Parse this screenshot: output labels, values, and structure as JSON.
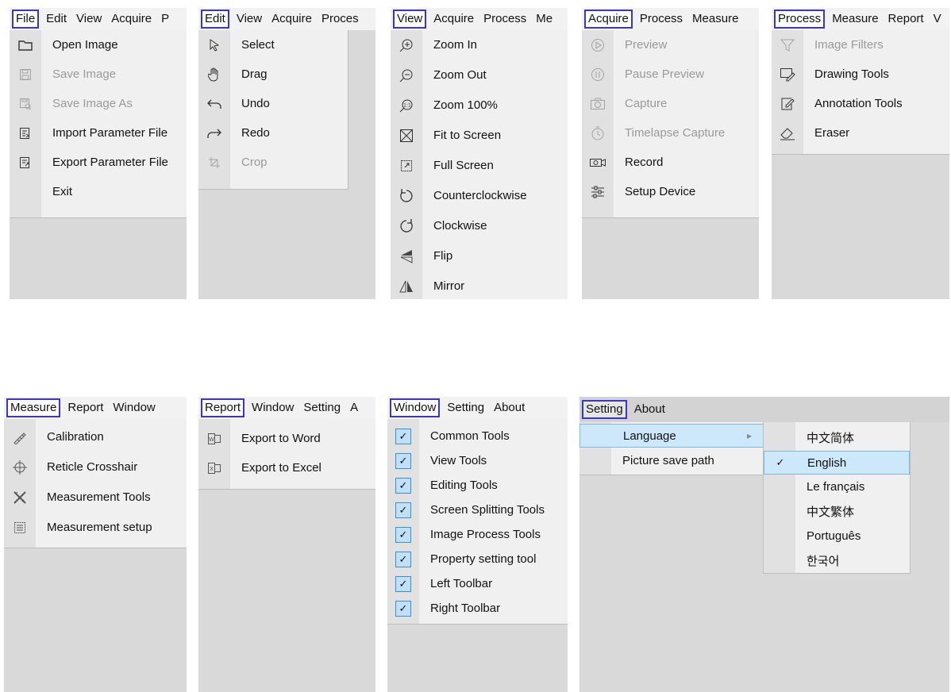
{
  "file_panel": {
    "bar": [
      "File",
      "Edit",
      "View",
      "Acquire",
      "P"
    ],
    "items": [
      {
        "label": "Open Image",
        "icon": "folder-icon",
        "disabled": false
      },
      {
        "label": "Save Image",
        "icon": "save-icon",
        "disabled": true
      },
      {
        "label": "Save Image As",
        "icon": "save-as-icon",
        "disabled": true
      },
      {
        "label": "Import Parameter File",
        "icon": "import-file-icon",
        "disabled": false
      },
      {
        "label": "Export Parameter File",
        "icon": "export-file-icon",
        "disabled": false
      },
      {
        "label": "Exit",
        "icon": "",
        "disabled": false
      }
    ]
  },
  "edit_panel": {
    "bar": [
      "Edit",
      "View",
      "Acquire",
      "Proces"
    ],
    "items": [
      {
        "label": "Select",
        "icon": "pointer-icon",
        "disabled": false
      },
      {
        "label": "Drag",
        "icon": "hand-icon",
        "disabled": false
      },
      {
        "label": "Undo",
        "icon": "undo-icon",
        "disabled": false
      },
      {
        "label": "Redo",
        "icon": "redo-icon",
        "disabled": false
      },
      {
        "label": "Crop",
        "icon": "crop-icon",
        "disabled": true
      }
    ]
  },
  "view_panel": {
    "bar": [
      "View",
      "Acquire",
      "Process",
      "Me"
    ],
    "items": [
      {
        "label": "Zoom In",
        "icon": "zoom-in-icon"
      },
      {
        "label": "Zoom Out",
        "icon": "zoom-out-icon"
      },
      {
        "label": "Zoom 100%",
        "icon": "zoom-100-icon"
      },
      {
        "label": "Fit to Screen",
        "icon": "fit-screen-icon"
      },
      {
        "label": "Full Screen",
        "icon": "full-screen-icon"
      },
      {
        "label": "Counterclockwise",
        "icon": "rotate-ccw-icon"
      },
      {
        "label": "Clockwise",
        "icon": "rotate-cw-icon"
      },
      {
        "label": "Flip",
        "icon": "flip-icon"
      },
      {
        "label": "Mirror",
        "icon": "mirror-icon"
      }
    ]
  },
  "acquire_panel": {
    "bar": [
      "Acquire",
      "Process",
      "Measure"
    ],
    "items": [
      {
        "label": "Preview",
        "icon": "play-icon",
        "disabled": true
      },
      {
        "label": "Pause Preview",
        "icon": "pause-icon",
        "disabled": true
      },
      {
        "label": "Capture",
        "icon": "camera-icon",
        "disabled": true
      },
      {
        "label": "Timelapse Capture",
        "icon": "timer-icon",
        "disabled": true
      },
      {
        "label": "Record",
        "icon": "record-icon",
        "disabled": false
      },
      {
        "label": "Setup Device",
        "icon": "sliders-icon",
        "disabled": false
      }
    ]
  },
  "process_panel": {
    "bar": [
      "Process",
      "Measure",
      "Report",
      "V"
    ],
    "items": [
      {
        "label": "Image Filters",
        "icon": "filter-icon",
        "disabled": true
      },
      {
        "label": "Drawing Tools",
        "icon": "drawing-icon",
        "disabled": false
      },
      {
        "label": "Annotation Tools",
        "icon": "annotation-icon",
        "disabled": false
      },
      {
        "label": "Eraser",
        "icon": "eraser-icon",
        "disabled": false
      }
    ]
  },
  "measure_panel": {
    "bar": [
      "Measure",
      "Report",
      "Window"
    ],
    "items": [
      {
        "label": "Calibration",
        "icon": "calibration-icon"
      },
      {
        "label": "Reticle Crosshair",
        "icon": "crosshair-icon"
      },
      {
        "label": "Measurement Tools",
        "icon": "measure-tools-icon"
      },
      {
        "label": "Measurement setup",
        "icon": "measure-setup-icon"
      }
    ]
  },
  "report_panel": {
    "bar": [
      "Report",
      "Window",
      "Setting",
      "A"
    ],
    "items": [
      {
        "label": "Export to Word",
        "icon": "word-icon"
      },
      {
        "label": "Export to Excel",
        "icon": "excel-icon"
      }
    ]
  },
  "window_panel": {
    "bar": [
      "Window",
      "Setting",
      "About"
    ],
    "items": [
      {
        "label": "Common Tools",
        "checked": true
      },
      {
        "label": "View Tools",
        "checked": true
      },
      {
        "label": "Editing Tools",
        "checked": true
      },
      {
        "label": "Screen Splitting Tools",
        "checked": true
      },
      {
        "label": "Image Process Tools",
        "checked": true
      },
      {
        "label": "Property setting tool",
        "checked": true
      },
      {
        "label": "Left Toolbar",
        "checked": true
      },
      {
        "label": "Right Toolbar",
        "checked": true
      }
    ]
  },
  "setting_panel": {
    "bar": [
      "Setting",
      "About"
    ],
    "items": [
      {
        "label": "Language",
        "submenu_arrow": "▸"
      },
      {
        "label": "Picture save path"
      }
    ],
    "languages": [
      {
        "label": "中文简体",
        "checked": false
      },
      {
        "label": "English",
        "checked": true
      },
      {
        "label": "Le français",
        "checked": false
      },
      {
        "label": "中文繁体",
        "checked": false
      },
      {
        "label": "Português",
        "checked": false
      },
      {
        "label": "한국어",
        "checked": false
      }
    ]
  },
  "colors": {
    "highlight_border": "#3b36c9",
    "panel_bg": "#d9d9d9",
    "menu_bg": "#f0f0f0",
    "check_fill": "#bfe0f7",
    "selection_bg": "#cde8fb"
  }
}
